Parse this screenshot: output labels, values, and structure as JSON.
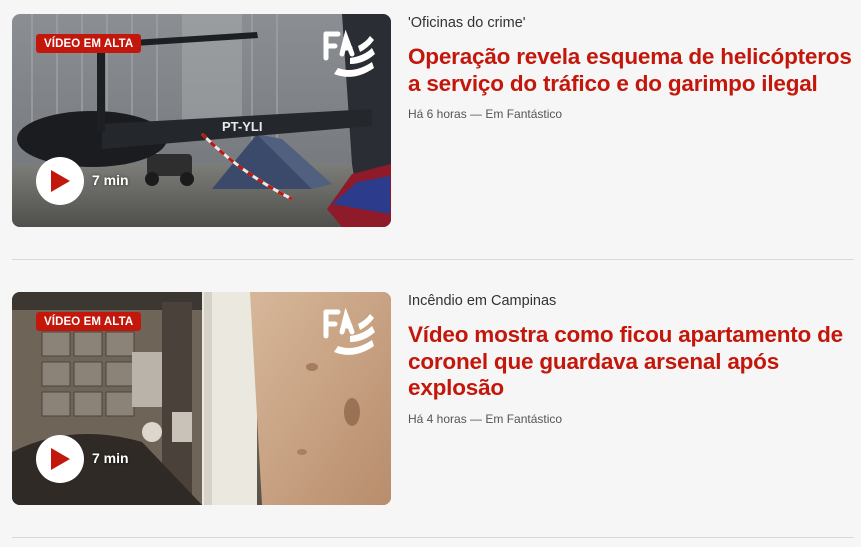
{
  "colors": {
    "accent": "#c4170c",
    "text": "#333333",
    "meta": "#555555"
  },
  "items": [
    {
      "badge": "VÍDEO EM ALTA",
      "duration": "7 min",
      "hat": "'Oficinas do crime'",
      "headline": "Operação revela esquema de helicópteros a serviço do tráfico e do garimpo ilegal",
      "time": "Há 6 horas",
      "separator": "—",
      "source": "Em Fantástico",
      "registration": "PT-YLI"
    },
    {
      "badge": "VÍDEO EM ALTA",
      "duration": "7 min",
      "hat": "Incêndio em Campinas",
      "headline": "Vídeo mostra como ficou apartamento de coronel que guardava arsenal após explosão",
      "time": "Há 4 horas",
      "separator": "—",
      "source": "Em Fantástico"
    }
  ]
}
